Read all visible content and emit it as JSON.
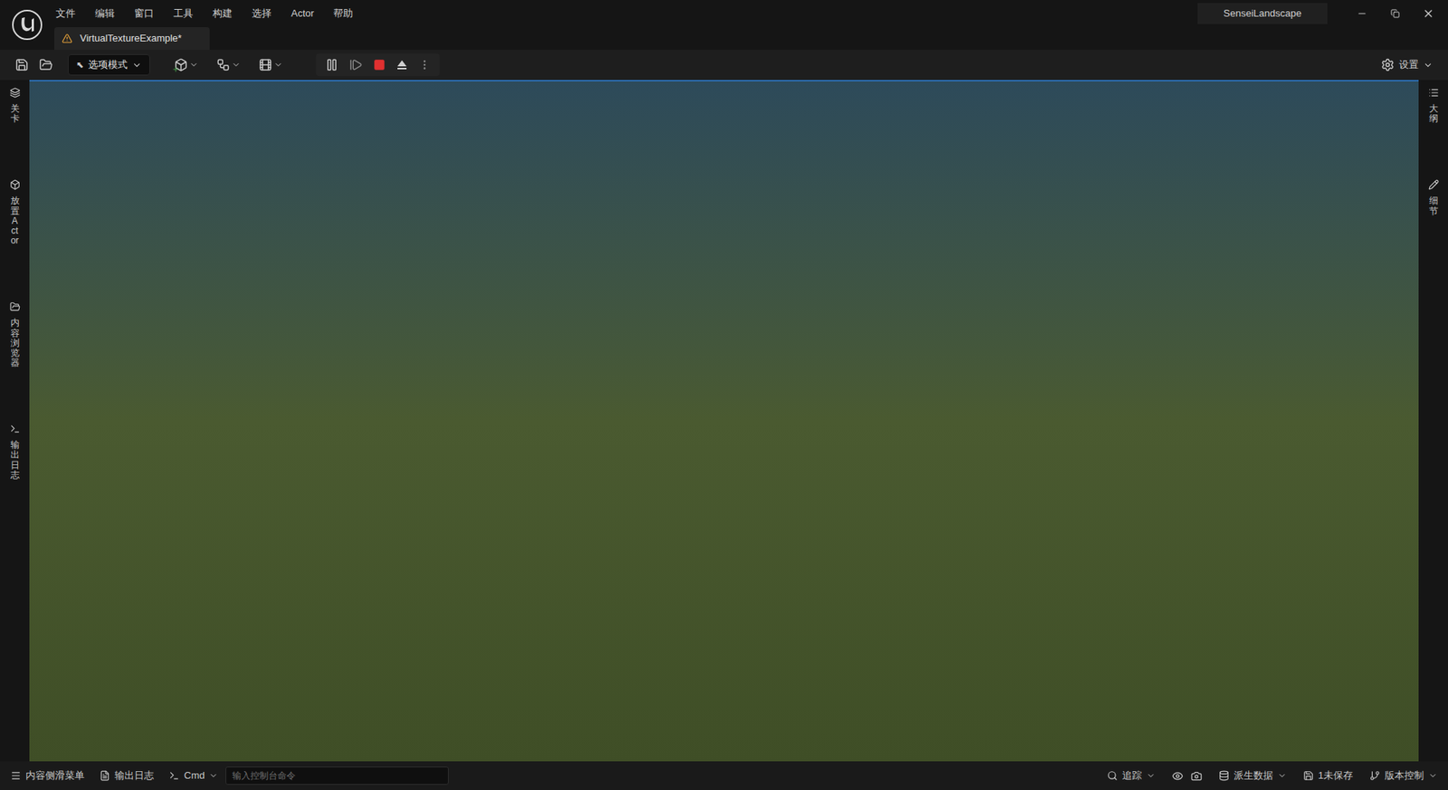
{
  "window": {
    "title": "SenseiLandscape"
  },
  "menu": [
    "文件",
    "编辑",
    "窗口",
    "工具",
    "构建",
    "选择",
    "Actor",
    "帮助"
  ],
  "tab": {
    "label": "VirtualTextureExample*"
  },
  "toolbar": {
    "mode": "选项模式",
    "settings": "设置",
    "playing": true
  },
  "left_rail": [
    {
      "label": "关卡"
    },
    {
      "label": "放置Actor"
    },
    {
      "label": "内容浏览器"
    },
    {
      "label": "输出日志"
    }
  ],
  "right_rail": [
    {
      "label": "大纲"
    },
    {
      "label": "细节"
    }
  ],
  "status_bar": {
    "drawer": "内容侧滑菜单",
    "log": "输出日志",
    "cmd": "Cmd",
    "placeholder": "输入控制台命令",
    "trace": "追踪",
    "ddc": "派生数据",
    "unsaved": "1未保存",
    "vcs": "版本控制"
  }
}
